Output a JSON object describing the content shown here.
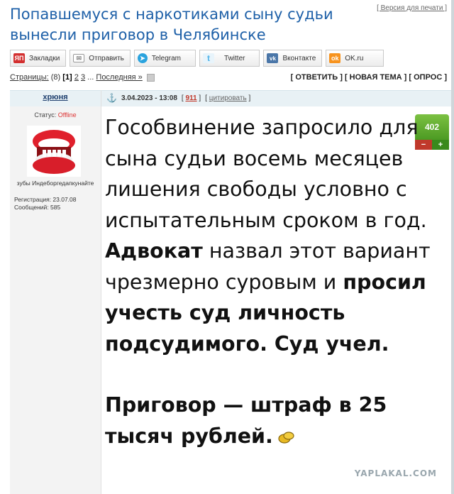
{
  "topic": {
    "title": "Попавшемуся с наркотиками сыну судьи вынесли приговор в Челябинске",
    "print_version": "[ Версия для печати ]"
  },
  "share_buttons": [
    {
      "label": "Закладки",
      "icon": "yandex-bookmarks-icon",
      "color": "#d32f2f",
      "glyph": "Я"
    },
    {
      "label": "Отправить",
      "icon": "envelope-icon",
      "color": "#9aa0a6",
      "glyph": "✉"
    },
    {
      "label": "Telegram",
      "icon": "telegram-icon",
      "color": "#2aa3de",
      "glyph": "➤"
    },
    {
      "label": "Twitter",
      "icon": "twitter-icon",
      "color": "#4fb3e8",
      "glyph": "t"
    },
    {
      "label": "Вконтакте",
      "icon": "vk-icon",
      "color": "#4a76a8",
      "glyph": "vk"
    },
    {
      "label": "OK.ru",
      "icon": "odnoklassniki-icon",
      "color": "#f7931e",
      "glyph": "ок"
    }
  ],
  "pager": {
    "label": "Страницы:",
    "count": "(8)",
    "current": "[1]",
    "p2": "2",
    "p3": "3",
    "ellipsis": "...",
    "last": "Последняя »"
  },
  "actions": {
    "reply": "[ ОТВЕТИТЬ ]",
    "new_topic": "[ НОВАЯ ТЕМА ]",
    "poll": "[ ОПРОС ]"
  },
  "post": {
    "author": "хрюня",
    "status_label": "Статус:",
    "status_value": "Offline",
    "nick": "зубы Индеборгедапкунайте",
    "registration": "Регистрация: 23.07.08",
    "messages": "Сообщений: 585",
    "datetime": "3.04.2023 - 13:08",
    "number": "911",
    "cite": "цитировать",
    "rating": "402",
    "rating_minus": "−",
    "rating_plus": "+",
    "text_p1_a": "Гособвинение запросило для сына судьи восемь месяцев лишения свободы условно с испытательным сроком в год. ",
    "text_p1_b": "Адвокат",
    "text_p1_c": " назвал этот вариант чрезмерно суровым и ",
    "text_p1_d": "просил учесть суд личность подсудимого. Суд учел.",
    "text_p2": "Приговор — штраф в 25 тысяч рублей."
  },
  "watermark": "YAPLAKAL.COM"
}
